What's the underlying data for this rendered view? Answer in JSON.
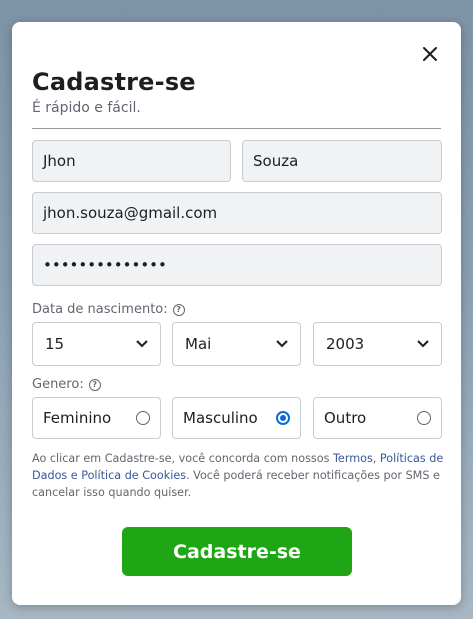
{
  "modal": {
    "title": "Cadastre-se",
    "subtitle": "É rápido e fácil.",
    "close_icon": "close-icon"
  },
  "fields": {
    "first_name": "Jhon",
    "last_name": "Souza",
    "email": "jhon.souza@gmail.com",
    "password": "••••••••••••••"
  },
  "birth": {
    "label": "Data de nascimento:",
    "day": "15",
    "month": "Mai",
    "year": "2003"
  },
  "gender": {
    "label": "Genero:",
    "options": [
      "Feminino",
      "Masculino",
      "Outro"
    ],
    "selected": "Masculino"
  },
  "terms": {
    "prefix": "Ao clicar em Cadastre-se, você concorda com nossos ",
    "link_terms": "Termos",
    "sep": ", ",
    "link_policy": "Políticas de Dados e Política de Cookies",
    "suffix": ". Você poderá receber notificações por SMS e cancelar isso quando quiser."
  },
  "submit_label": "Cadastre-se",
  "colors": {
    "primary_button": "#1ea614",
    "link": "#385898",
    "radio_selected": "#0b6cd8"
  }
}
